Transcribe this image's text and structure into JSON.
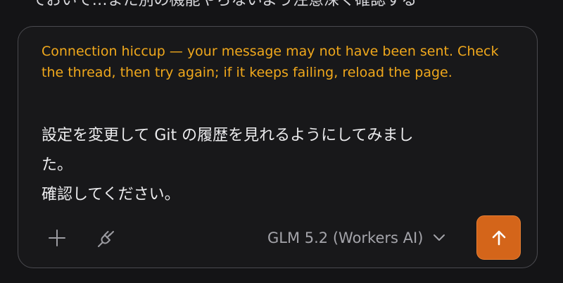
{
  "background": {
    "scrolled_text": "ておいて…また別の機能やらないよう注意深く確認する"
  },
  "composer": {
    "error_message": "Connection hiccup — your message may not have been sent. Check the thread, then try again; if it keeps failing, reload the page.",
    "message_lines": [
      "設定を変更して Git の履歴を見れるようにしてみまし",
      "た。",
      "確認してください。"
    ],
    "toolbar": {
      "add_icon": "plus-icon",
      "connect_icon": "plug-icon",
      "model_label": "GLM 5.2 (Workers AI)",
      "model_dropdown_icon": "chevron-down-icon",
      "send_icon": "arrow-up-icon"
    }
  },
  "colors": {
    "error": "#f0a81c",
    "accent": "#d4651a",
    "border": "#4a4a4f",
    "background": "#141416"
  }
}
